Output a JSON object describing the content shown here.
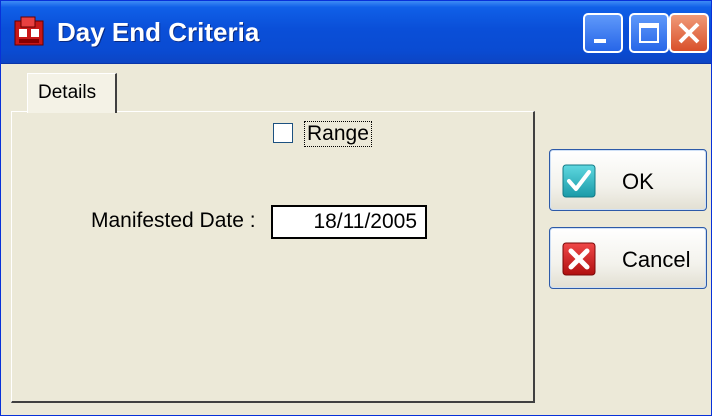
{
  "window": {
    "title": "Day End Criteria",
    "title_color": "#ffffff",
    "titlebar_color": "#0a4fd8"
  },
  "titlebar_buttons": {
    "minimize_icon": "minimize-icon",
    "maximize_icon": "maximize-icon",
    "close_icon": "close-icon"
  },
  "tabs": [
    {
      "label": "Details",
      "selected": true
    }
  ],
  "form": {
    "range_checkbox": {
      "label": "Range",
      "checked": false
    },
    "manifested_date": {
      "label": "Manifested Date :",
      "value": "18/11/2005"
    }
  },
  "buttons": {
    "ok_label": "OK",
    "cancel_label": "Cancel"
  }
}
